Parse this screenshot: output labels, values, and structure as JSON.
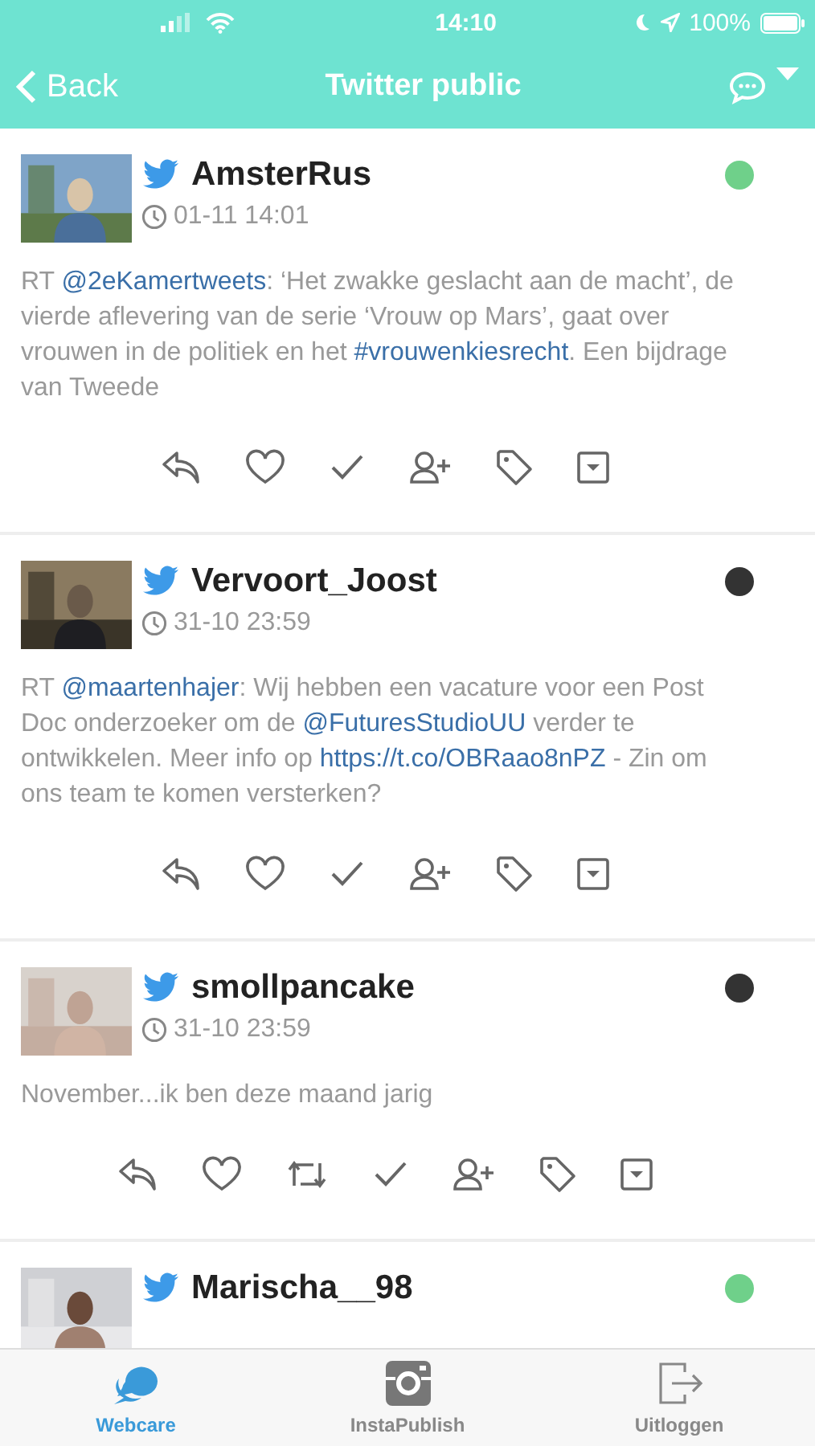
{
  "status_bar": {
    "time": "14:10",
    "battery": "100%"
  },
  "nav": {
    "back": "Back",
    "title": "Twitter public"
  },
  "tweets": [
    {
      "user": "AmsterRus",
      "time": "01-11 14:01",
      "color": "#6fd08a",
      "text": [
        {
          "t": "RT "
        },
        {
          "t": "@2eKamertweets",
          "link": true
        },
        {
          "t": ": ‘Het zwakke geslacht aan de macht’, de vierde aflevering van de serie ‘Vrouw op Mars’, gaat over vrouwen in de politiek en het "
        },
        {
          "t": "#vrouwenkiesrecht",
          "link": true
        },
        {
          "t": ". Een bijdrage van Tweede"
        }
      ],
      "actions": [
        {
          "kind": "reply"
        },
        {
          "kind": "like"
        },
        {
          "kind": "check"
        },
        {
          "kind": "follow"
        },
        {
          "kind": "tag"
        },
        {
          "kind": "archive"
        }
      ]
    },
    {
      "user": "Vervoort_Joost",
      "time": "31-10 23:59",
      "color": "#333333",
      "text": [
        {
          "t": "RT "
        },
        {
          "t": "@maartenhajer",
          "link": true
        },
        {
          "t": ": Wij hebben een vacature voor een Post Doc onderzoeker om de "
        },
        {
          "t": "@FuturesStudioUU",
          "link": true
        },
        {
          "t": " verder te ontwikkelen. Meer info op "
        },
        {
          "t": "https://t.co/OBRaao8nPZ",
          "link": true
        },
        {
          "t": " - Zin om ons team te komen versterken?"
        }
      ],
      "actions": [
        {
          "kind": "reply"
        },
        {
          "kind": "like"
        },
        {
          "kind": "check"
        },
        {
          "kind": "follow"
        },
        {
          "kind": "tag"
        },
        {
          "kind": "archive"
        }
      ]
    },
    {
      "user": "smollpancake",
      "time": "31-10 23:59",
      "color": "#333333",
      "text": [
        {
          "t": "November...ik ben deze maand jarig"
        }
      ],
      "actions": [
        {
          "kind": "reply"
        },
        {
          "kind": "like"
        },
        {
          "kind": "retweet"
        },
        {
          "kind": "check"
        },
        {
          "kind": "follow"
        },
        {
          "kind": "tag"
        },
        {
          "kind": "archive"
        }
      ]
    },
    {
      "user": "Marischa__98",
      "color": "#6fd08a"
    }
  ],
  "tabs": [
    {
      "label": "Webcare",
      "kind": "chat",
      "selected": true
    },
    {
      "label": "InstaPublish",
      "kind": "camera",
      "selected": false
    },
    {
      "label": "Uitloggen",
      "kind": "logout",
      "selected": false
    }
  ]
}
